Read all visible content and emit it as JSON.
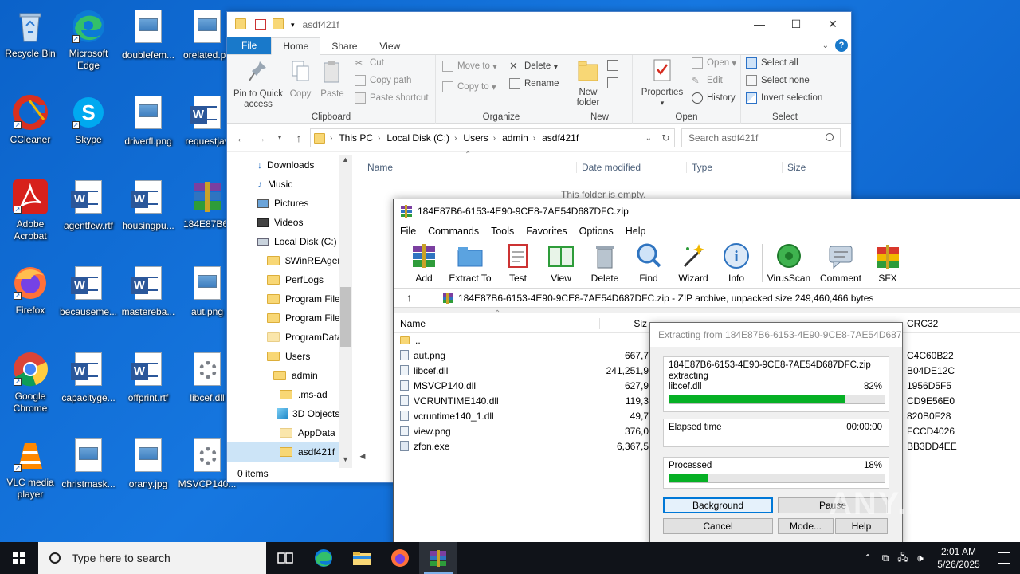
{
  "desktop": {
    "icons": [
      {
        "label": "Recycle Bin"
      },
      {
        "label": "Microsoft Edge"
      },
      {
        "label": "doublefem..."
      },
      {
        "label": "orelated.pn"
      },
      {
        "label": "CCleaner"
      },
      {
        "label": "Skype"
      },
      {
        "label": "driverfl.png"
      },
      {
        "label": "requestjav"
      },
      {
        "label": "Adobe Acrobat"
      },
      {
        "label": "agentfew.rtf"
      },
      {
        "label": "housingpu..."
      },
      {
        "label": "184E87B6-"
      },
      {
        "label": "Firefox"
      },
      {
        "label": "becauseme..."
      },
      {
        "label": "mastereba..."
      },
      {
        "label": "aut.png"
      },
      {
        "label": "Google Chrome"
      },
      {
        "label": "capacityge..."
      },
      {
        "label": "offprint.rtf"
      },
      {
        "label": "libcef.dll"
      },
      {
        "label": "VLC media player"
      },
      {
        "label": "christmask..."
      },
      {
        "label": "orany.jpg"
      },
      {
        "label": "MSVCP140..."
      }
    ]
  },
  "explorer": {
    "title": "asdf421f",
    "tabs": {
      "file": "File",
      "home": "Home",
      "share": "Share",
      "view": "View"
    },
    "clipboard": {
      "group": "Clipboard",
      "pin": "Pin to Quick access",
      "copy": "Copy",
      "paste": "Paste",
      "cut": "Cut",
      "copy_path": "Copy path",
      "paste_shortcut": "Paste shortcut"
    },
    "organize": {
      "group": "Organize",
      "move_to": "Move to",
      "copy_to": "Copy to",
      "delete": "Delete",
      "rename": "Rename"
    },
    "new": {
      "group": "New",
      "new_folder": "New folder"
    },
    "open": {
      "group": "Open",
      "properties": "Properties",
      "open": "Open",
      "edit": "Edit",
      "history": "History"
    },
    "select": {
      "group": "Select",
      "select_all": "Select all",
      "select_none": "Select none",
      "invert": "Invert selection"
    },
    "path": [
      "This PC",
      "Local Disk (C:)",
      "Users",
      "admin",
      "asdf421f"
    ],
    "search_placeholder": "Search asdf421f",
    "nav": [
      {
        "label": "Downloads"
      },
      {
        "label": "Music"
      },
      {
        "label": "Pictures"
      },
      {
        "label": "Videos"
      },
      {
        "label": "Local Disk (C:)"
      },
      {
        "label": "$WinREAgent"
      },
      {
        "label": "PerfLogs"
      },
      {
        "label": "Program Files"
      },
      {
        "label": "Program Files"
      },
      {
        "label": "ProgramData"
      },
      {
        "label": "Users"
      },
      {
        "label": "admin"
      },
      {
        "label": ".ms-ad"
      },
      {
        "label": "3D Objects"
      },
      {
        "label": "AppData"
      },
      {
        "label": "asdf421f"
      }
    ],
    "columns": {
      "name": "Name",
      "date": "Date modified",
      "type": "Type",
      "size": "Size"
    },
    "empty_text": "This folder is empty.",
    "status": "0 items"
  },
  "winrar": {
    "title": "184E87B6-6153-4E90-9CE8-7AE54D687DFC.zip",
    "menu": [
      "File",
      "Commands",
      "Tools",
      "Favorites",
      "Options",
      "Help"
    ],
    "tools": [
      "Add",
      "Extract To",
      "Test",
      "View",
      "Delete",
      "Find",
      "Wizard",
      "Info",
      "VirusScan",
      "Comment",
      "SFX"
    ],
    "address": "184E87B6-6153-4E90-9CE8-7AE54D687DFC.zip - ZIP archive, unpacked size 249,460,466 bytes",
    "columns": {
      "name": "Name",
      "size": "Siz",
      "crc": "CRC32"
    },
    "files": [
      {
        "name": "..",
        "size": "",
        "crc": ""
      },
      {
        "name": "aut.png",
        "size": "667,7",
        "crc": "C4C60B22"
      },
      {
        "name": "libcef.dll",
        "size": "241,251,9",
        "crc": "B04DE12C"
      },
      {
        "name": "MSVCP140.dll",
        "size": "627,9",
        "crc": "1956D5F5"
      },
      {
        "name": "VCRUNTIME140.dll",
        "size": "119,3",
        "crc": "CD9E56E0"
      },
      {
        "name": "vcruntime140_1.dll",
        "size": "49,7",
        "crc": "820B0F28"
      },
      {
        "name": "view.png",
        "size": "376,0",
        "crc": "FCCD4026"
      },
      {
        "name": "zfon.exe",
        "size": "6,367,5",
        "crc": "BB3DD4EE"
      }
    ]
  },
  "progress": {
    "title": "Extracting from 184E87B6-6153-4E90-9CE8-7AE54D687...",
    "archive": "184E87B6-6153-4E90-9CE8-7AE54D687DFC.zip",
    "action": "extracting",
    "file": "libcef.dll",
    "file_pct_text": "82%",
    "file_pct": 82,
    "elapsed_label": "Elapsed time",
    "elapsed": "00:00:00",
    "processed_label": "Processed",
    "processed_pct_text": "18%",
    "processed_pct": 18,
    "buttons": {
      "background": "Background",
      "pause": "Pause",
      "cancel": "Cancel",
      "mode": "Mode...",
      "help": "Help"
    }
  },
  "taskbar": {
    "search_placeholder": "Type here to search",
    "time": "2:01 AM",
    "date": "5/26/2025"
  },
  "watermark": "ANY.RUN"
}
